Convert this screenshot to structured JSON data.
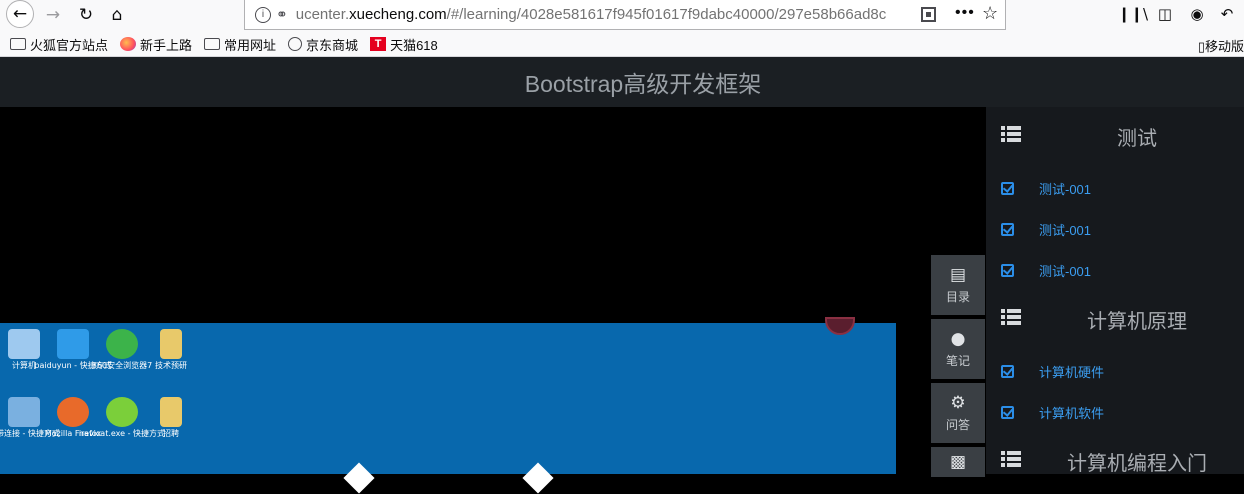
{
  "browser": {
    "url_host_prefix": "ucenter.",
    "url_host_domain": "xuecheng.com",
    "url_path": "/#/learning/4028e581617f945f01617f9dabc40000/297e58b66ad8c",
    "bookmarks": [
      "火狐官方站点",
      "新手上路",
      "常用网址",
      "京东商城",
      "天猫618"
    ],
    "bookmark_right": "移动版"
  },
  "app": {
    "title": "Bootstrap高级开发框架"
  },
  "side_tabs": [
    {
      "label": "目录",
      "icon": "list-icon"
    },
    {
      "label": "笔记",
      "icon": "user-icon"
    },
    {
      "label": "问答",
      "icon": "gear-icon"
    }
  ],
  "chapters": [
    {
      "title": "测试",
      "lessons": [
        "测试-001",
        "测试-001",
        "测试-001"
      ]
    },
    {
      "title": "计算机原理",
      "lessons": [
        "计算机硬件",
        "计算机软件"
      ]
    },
    {
      "title": "计算机编程入门",
      "lessons": []
    }
  ],
  "desktop_icons": [
    {
      "label": "计算机",
      "color": "#9ec9ef"
    },
    {
      "label": "baiduyun - 快捷方式",
      "color": "#2f9be8"
    },
    {
      "label": "360安全浏览器7",
      "color": "#3cb34a"
    },
    {
      "label": "技术预研",
      "color": "#e8c96a"
    },
    {
      "label": "宽带连接 - 快捷方式",
      "color": "#7ab0e0"
    },
    {
      "label": "Mozilla Firefox",
      "color": "#e86a2a"
    },
    {
      "label": "navicat.exe - 快捷方式",
      "color": "#7bcf3a"
    },
    {
      "label": "招聘",
      "color": "#e8c96a"
    }
  ]
}
